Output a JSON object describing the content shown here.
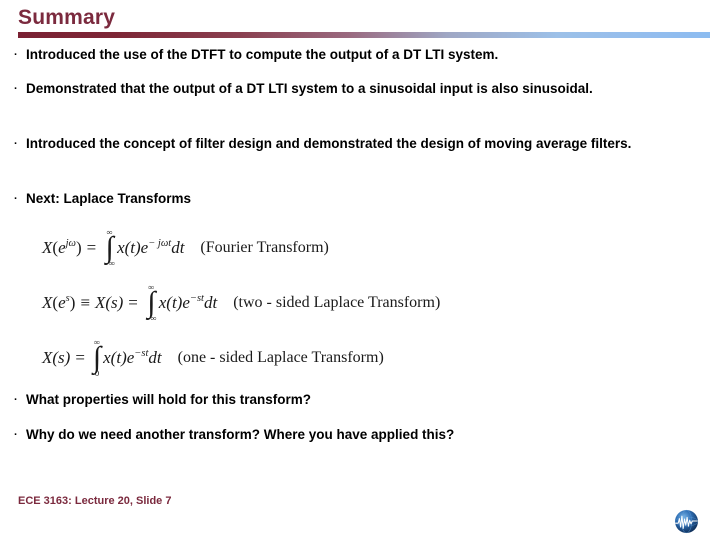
{
  "slide": {
    "title": "Summary",
    "bullets": [
      {
        "marker": "·",
        "text": "Introduced the use of the DTFT to compute the output of a DT LTI system."
      },
      {
        "marker": "·",
        "text": "Demonstrated that the output of a DT LTI system to a sinusoidal input is also sinusoidal."
      },
      {
        "marker": "·",
        "text": "Introduced the concept of filter design and demonstrated the design of moving average filters."
      },
      {
        "marker": "·",
        "text": "Next: Laplace Transforms"
      },
      {
        "marker": "·",
        "text": "What properties will hold for this transform?"
      },
      {
        "marker": "·",
        "text": "Why do we need another transform? Where you have applied this?"
      }
    ],
    "equations": [
      {
        "lhs": "X",
        "lhs_arg_open": "(",
        "lhs_base": "e",
        "lhs_exp": "jω",
        "lhs_arg_close": ")",
        "relation": "=",
        "integral_upper": "∞",
        "integral_lower": "−∞",
        "integrand": "x(t)e",
        "integrand_exp": "− jωt",
        "differential": "dt",
        "caption": "(Fourier Transform)"
      },
      {
        "lhs": "X",
        "lhs_arg_open": "(",
        "lhs_base": "e",
        "lhs_exp": "s",
        "lhs_arg_close": ")",
        "identity": "≡",
        "lhs2": "X(s)",
        "relation": "=",
        "integral_upper": "∞",
        "integral_lower": "−∞",
        "integrand": "x(t)e",
        "integrand_exp": "−st",
        "differential": "dt",
        "caption": "(two - sided Laplace Transform)"
      },
      {
        "lhs2": "X(s)",
        "relation": "=",
        "integral_upper": "∞",
        "integral_lower": "0",
        "integrand": "x(t)e",
        "integrand_exp": "−st",
        "differential": "dt",
        "caption": "(one - sided Laplace Transform)"
      }
    ],
    "footer": "ECE 3163: Lecture 20, Slide 7",
    "colors": {
      "title": "#7b2a3e",
      "rule_start": "#7a2133",
      "rule_end": "#8cbcf0",
      "footer": "#7b2a3e",
      "body_text": "#000000"
    },
    "logo_name": "globe-waveform-logo"
  }
}
